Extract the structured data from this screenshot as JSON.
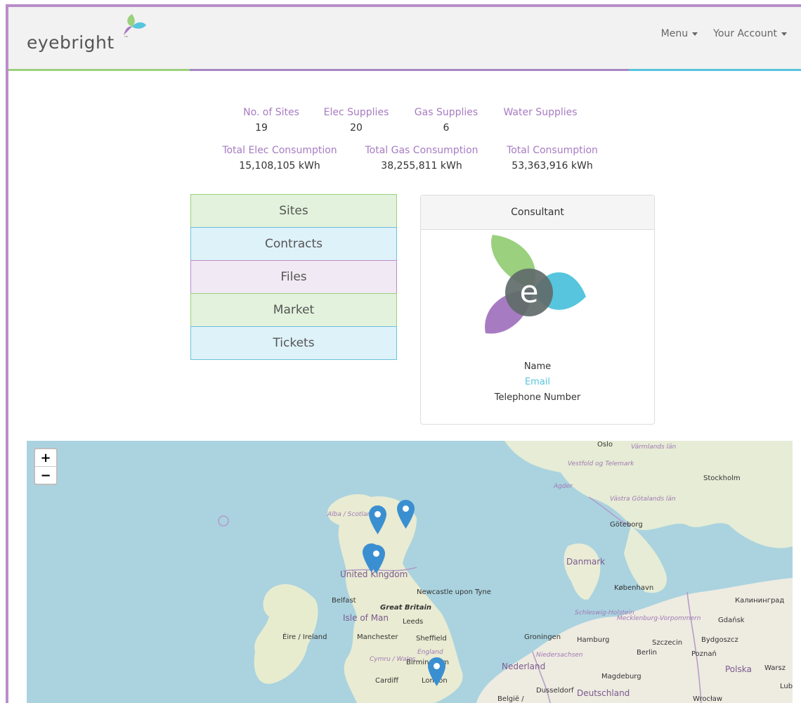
{
  "app": {
    "logo_text": "eyebright",
    "logo_tm": "™"
  },
  "nav": {
    "menu_label": "Menu",
    "account_label": "Your Account"
  },
  "stats": {
    "sites_label": "No. of Sites",
    "sites_value": "19",
    "elec_label": "Elec Supplies",
    "elec_value": "20",
    "gas_label": "Gas Supplies",
    "gas_value": "6",
    "water_label": "Water Supplies",
    "water_value": "",
    "total_elec_label": "Total Elec Consumption",
    "total_elec_value": "15,108,105 kWh",
    "total_gas_label": "Total Gas Consumption",
    "total_gas_value": "38,255,811 kWh",
    "total_label": "Total Consumption",
    "total_value": "53,363,916 kWh"
  },
  "menu_buttons": [
    "Sites",
    "Contracts",
    "Files",
    "Market",
    "Tickets"
  ],
  "consultant": {
    "header": "Consultant",
    "logo_letter": "e",
    "name": "Name",
    "email": "Email",
    "telephone": "Telephone Number"
  },
  "map": {
    "zoom_in": "+",
    "zoom_out": "−",
    "labels": {
      "oslo": "Oslo",
      "varmlands": "Värmlands län",
      "vestfold": "Vestfold og Telemark",
      "stockholm": "Stockholm",
      "agder": "Agder",
      "vastra": "Västra Götalands län",
      "goteborg": "Göteborg",
      "alba": "Alba / Scotland",
      "danmark": "Danmark",
      "kobenhavn": "København",
      "uk": "United Kingdom",
      "newcastle": "Newcastle upon Tyne",
      "belfast": "Belfast",
      "great_britain": "Great Britain",
      "isle_of_man": "Isle of Man",
      "leeds": "Leeds",
      "kaliningrad": "Калининград",
      "schleswig": "Schleswig-Holstein",
      "mecklenburg": "Mecklenburg-Vorpommern",
      "gdansk": "Gdańsk",
      "eire": "Éire / Ireland",
      "manchester": "Manchester",
      "sheffield": "Sheffield",
      "groningen": "Groningen",
      "hamburg": "Hamburg",
      "szczecin": "Szczecin",
      "bydgoszcz": "Bydgoszcz",
      "england": "England",
      "cymru": "Cymru / Wales",
      "birmingham": "Birmingham",
      "niedersachsen": "Niedersachsen",
      "berlin": "Berlin",
      "poznan": "Poznań",
      "nederland": "Nederland",
      "polska": "Polska",
      "warszawa": "Warsz",
      "cardiff": "Cardiff",
      "london": "London",
      "magdeburg": "Magdeburg",
      "dusseldorf": "Dusseldorf",
      "deutschland": "Deutschland",
      "belgie": "België /",
      "lub": "Lub",
      "wroclaw": "Wrocław"
    }
  },
  "colors": {
    "green": "#9bd07e",
    "blue": "#57c5de",
    "purple": "#a77bc2",
    "marker": "#3a8fd1",
    "sea": "#aad3df",
    "land": "#f0ede4"
  }
}
